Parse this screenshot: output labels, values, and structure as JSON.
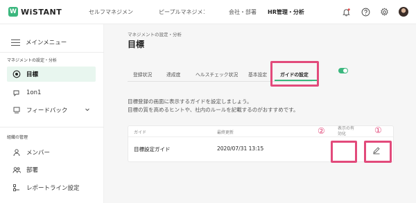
{
  "header": {
    "logo_mark": "W",
    "logo_text": "WiSTANT",
    "nav": [
      "セルフマネジメント",
      "ピープルマネジメント",
      "会社・部署",
      "HR管理・分析"
    ],
    "active_nav_index": 3
  },
  "sidebar": {
    "menu_label": "メインメニュー",
    "section1_label": "マネジメントの設定・分析",
    "items1": [
      {
        "label": "目標",
        "icon": "target-icon",
        "active": true
      },
      {
        "label": "1on1",
        "icon": "chat-icon",
        "active": false
      },
      {
        "label": "フィードバック",
        "icon": "feedback-icon",
        "active": false,
        "has_chevron": true
      }
    ],
    "section2_label": "組織の管理",
    "items2": [
      {
        "label": "メンバー",
        "icon": "person-icon"
      },
      {
        "label": "部署",
        "icon": "group-icon"
      },
      {
        "label": "レポートライン設定",
        "icon": "reportline-icon"
      }
    ]
  },
  "main": {
    "breadcrumb": "マネジメントの設定・分析",
    "title": "目標",
    "tabs": [
      "登録状況",
      "達成度",
      "ヘルスチェック状況",
      "基本設定",
      "ガイドの設定"
    ],
    "active_tab_index": 4,
    "description_line1": "目標登録の画面に表示するガイドを設定しましょう。",
    "description_line2": "目標の質を高めるヒントや、社内のルールを記載するのがおすすめです。",
    "table": {
      "columns": [
        "ガイド",
        "最終更新",
        "表示の有効化"
      ],
      "rows": [
        {
          "guide": "目標設定ガイド",
          "updated": "2020/07/31 13:15",
          "enabled": true
        }
      ]
    }
  },
  "annotations": {
    "marker1": "①",
    "marker2": "②",
    "highlight_color": "#e24a7b"
  },
  "colors": {
    "accent": "#3bb77e",
    "highlight": "#e24a7b"
  }
}
